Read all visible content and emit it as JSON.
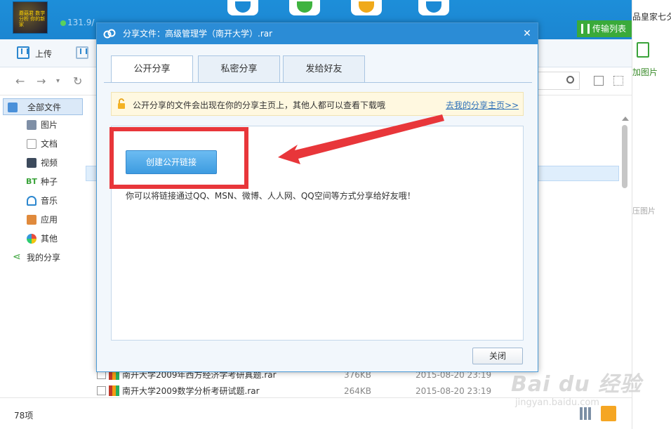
{
  "app": {
    "quota_text": "131.9/",
    "right_edge_top": "品皇家七夕",
    "right_edge_add": "加图片",
    "right_edge_mid": "压图片",
    "transfer_label": "传输列表",
    "avatar_text": "蘑菇君 数学分析 你的新家"
  },
  "toolbar": {
    "upload_label": "上传"
  },
  "sidebar": {
    "items": [
      {
        "label": "全部文件",
        "icon": "folder-icon"
      },
      {
        "label": "图片",
        "icon": "image-icon"
      },
      {
        "label": "文档",
        "icon": "document-icon"
      },
      {
        "label": "视频",
        "icon": "video-icon"
      },
      {
        "label": "种子",
        "icon": "bt-icon"
      },
      {
        "label": "音乐",
        "icon": "music-icon"
      },
      {
        "label": "应用",
        "icon": "app-icon"
      },
      {
        "label": "其他",
        "icon": "other-icon"
      },
      {
        "label": "我的分享",
        "icon": "share-icon"
      }
    ],
    "bt_text": "BT"
  },
  "files": [
    {
      "name": "南开大学2009年西方经济学考研真题.rar",
      "size": "376KB",
      "date": "2015-08-20 23:19"
    },
    {
      "name": "南开大学2009数学分析考研试题.rar",
      "size": "264KB",
      "date": "2015-08-20 23:19"
    }
  ],
  "status": {
    "count": "78项"
  },
  "dialog": {
    "title": "分享文件：高级管理学（南开大学）.rar",
    "tabs": [
      "公开分享",
      "私密分享",
      "发给好友"
    ],
    "notice": "公开分享的文件会出现在你的分享主页上，其他人都可以查看下载哦",
    "notice_link": "去我的分享主页>>",
    "create_button": "创建公开链接",
    "description": "你可以将链接通过QQ、MSN、微博、人人网、QQ空间等方式分享给好友哦！",
    "close_button": "关闭"
  },
  "watermark": {
    "brand": "Bai du 经验",
    "url": "jingyan.baidu.com"
  },
  "colors": {
    "title_bar": "#2b8cd6",
    "annotation": "#e8363a",
    "primary_button": "#3d9be0"
  }
}
